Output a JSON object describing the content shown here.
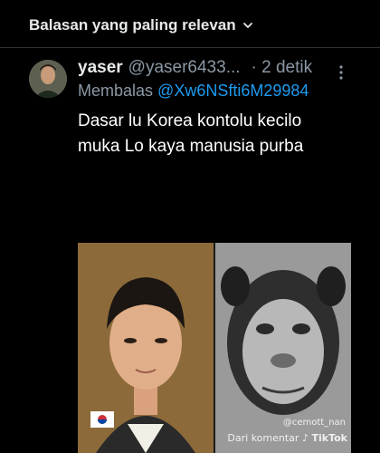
{
  "sort": {
    "label": "Balasan yang paling relevan",
    "chevron_icon": "chevron-down-icon"
  },
  "tweet": {
    "display_name": "yaser",
    "handle": "@yaser6433...",
    "time": "· 2 detik",
    "reply_prefix": "Membalas",
    "reply_to": "@Xw6NSfti6M29984",
    "text_line1": "Dasar lu Korea kontolu kecilo",
    "text_line2": "muka Lo kaya manusia purba"
  },
  "media": {
    "watermark_handle": "@cemott_nan",
    "watermark_source": "Dari komentar",
    "brand": "TikTok"
  },
  "colors": {
    "background": "#000000",
    "text": "#e7e9ea",
    "muted": "#8b98a5",
    "link": "#1d9bf0"
  }
}
